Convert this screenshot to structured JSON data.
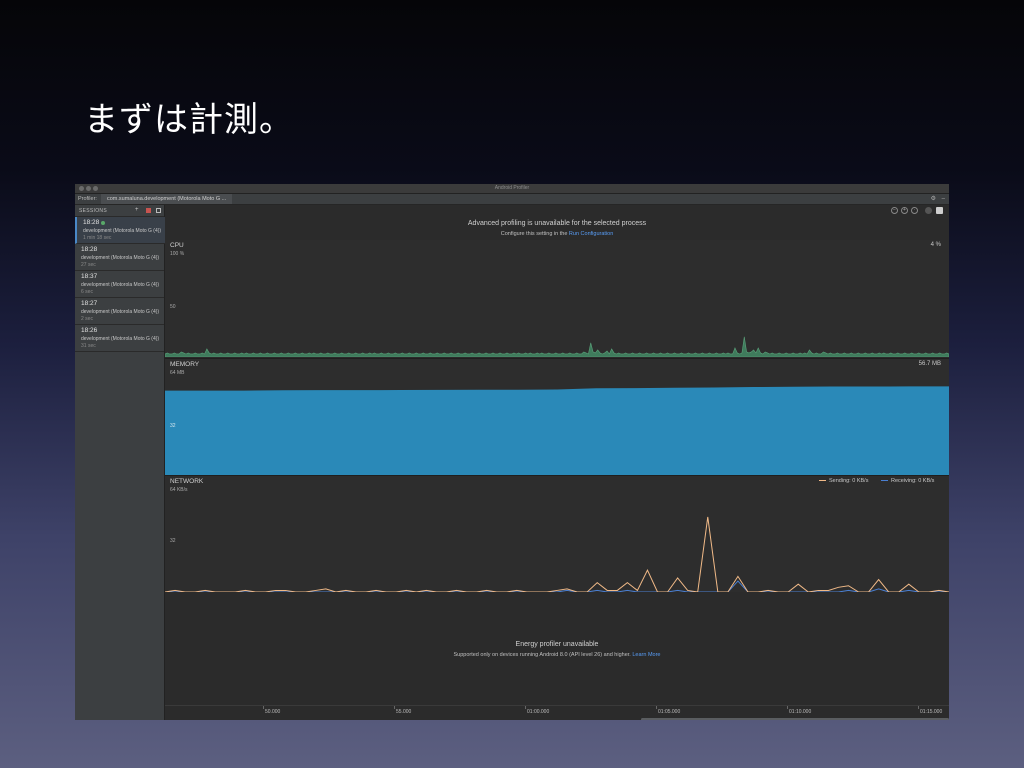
{
  "slide": {
    "title": "まずは計測。"
  },
  "window": {
    "title": "Android Profiler"
  },
  "toolbar": {
    "label": "Profiler:",
    "tab": "com.sumaluna.development (Motorola Moto G ...",
    "settings_icon": "gear-icon",
    "minimize_icon": "minimize-icon"
  },
  "sidebar": {
    "header": "SESSIONS",
    "add_icon": "plus-icon",
    "stop_icon": "stop-icon",
    "collapse_icon": "panel-collapse-icon",
    "sessions": [
      {
        "time": "18:28",
        "name": "development (Motorola Moto G (4))",
        "duration": "1 min 18 sec",
        "live": true
      },
      {
        "time": "18:28",
        "name": "development (Motorola Moto G (4))",
        "duration": "27 sec"
      },
      {
        "time": "18:37",
        "name": "development (Motorola Moto G (4))",
        "duration": "6 sec"
      },
      {
        "time": "18:27",
        "name": "development (Motorola Moto G (4))",
        "duration": "2 sec"
      },
      {
        "time": "18:26",
        "name": "development (Motorola Moto G (4))",
        "duration": "31 sec"
      }
    ]
  },
  "banner": {
    "title": "Advanced profiling is unavailable for the selected process",
    "subtitle_prefix": "Configure this setting in the ",
    "subtitle_link": "Run Configuration"
  },
  "cpu": {
    "label": "CPU",
    "value": "4 %",
    "tick_top": "100 %",
    "tick_mid": "50",
    "color": "#3f7b5c",
    "ylim": [
      0,
      100
    ],
    "samples": [
      3,
      4,
      3,
      3,
      4,
      3,
      3,
      5,
      4,
      3,
      4,
      3,
      3,
      4,
      3,
      3,
      4,
      3,
      8,
      4,
      3,
      4,
      3,
      3,
      4,
      3,
      3,
      4,
      3,
      3,
      4,
      3,
      3,
      4,
      3,
      4,
      3,
      3,
      4,
      3,
      3,
      4,
      3,
      3,
      4,
      3,
      3,
      4,
      3,
      3,
      4,
      3,
      3,
      4,
      3,
      3,
      4,
      3,
      3,
      4,
      3,
      3,
      4,
      3,
      4,
      3,
      3,
      4,
      3,
      3,
      4,
      3,
      3,
      4,
      3,
      3,
      4,
      3,
      3,
      4,
      3,
      3,
      4,
      3,
      3,
      4,
      3,
      3,
      4,
      3,
      4,
      3,
      3,
      4,
      3,
      3,
      4,
      3,
      3,
      4,
      3,
      3,
      4,
      3,
      3,
      4,
      3,
      3,
      4,
      3,
      3,
      4,
      3,
      3,
      4,
      3,
      3,
      4,
      3,
      3,
      4,
      3,
      3,
      4,
      3,
      3,
      4,
      3,
      3,
      4,
      3,
      3,
      4,
      3,
      3,
      4,
      3,
      3,
      4,
      3,
      3,
      4,
      3,
      3,
      4,
      3,
      3,
      4,
      3,
      3,
      4,
      3,
      4,
      3,
      3,
      4,
      3,
      4,
      3,
      3,
      4,
      3,
      4,
      3,
      3,
      4,
      3,
      3,
      4,
      3,
      3,
      4,
      3,
      3,
      4,
      3,
      3,
      4,
      3,
      3,
      5,
      4,
      3,
      14,
      5,
      4,
      7,
      4,
      3,
      4,
      6,
      3,
      8,
      4,
      3,
      4,
      3,
      3,
      4,
      3,
      3,
      4,
      3,
      3,
      4,
      3,
      3,
      4,
      3,
      3,
      4,
      3,
      3,
      4,
      3,
      3,
      4,
      3,
      3,
      4,
      3,
      3,
      4,
      3,
      3,
      4,
      3,
      3,
      4,
      3,
      3,
      4,
      3,
      3,
      4,
      3,
      3,
      4,
      3,
      3,
      4,
      3,
      4,
      3,
      3,
      9,
      4,
      3,
      4,
      20,
      5,
      4,
      5,
      7,
      4,
      9,
      4,
      3,
      5,
      4,
      3,
      4,
      3,
      3,
      4,
      3,
      3,
      4,
      3,
      3,
      4,
      3,
      3,
      4,
      3,
      4,
      3,
      7,
      4,
      3,
      4,
      3,
      3,
      5,
      4,
      3,
      4,
      3,
      3,
      4,
      3,
      3,
      4,
      3,
      3,
      4,
      3,
      3,
      4,
      3,
      3,
      4,
      3,
      3,
      4,
      3,
      3,
      4,
      3,
      4,
      3,
      3,
      4,
      3,
      3,
      4,
      3,
      3,
      4,
      3,
      3,
      4,
      3,
      3,
      4,
      3,
      3,
      4,
      3,
      3,
      4,
      3,
      3,
      4,
      3,
      3,
      4,
      3
    ]
  },
  "memory": {
    "label": "MEMORY",
    "value": "56.7 MB",
    "tick_top": "64 MB",
    "tick_mid": "32",
    "color": "#2a89b8",
    "ylim": [
      0,
      64
    ],
    "samples": [
      54,
      54,
      54,
      54.2,
      54.3,
      54.3,
      54.4,
      54.5,
      54.6,
      54.6,
      54.7,
      55.5,
      55.6,
      55.8,
      56,
      56.3,
      56.5,
      56.6,
      56.6,
      56.7,
      56.7
    ]
  },
  "network": {
    "label": "NETWORK",
    "tick_top": "64 KB/s",
    "tick_mid": "32",
    "ylim": [
      0,
      64
    ],
    "sending_label": "Sending: 0 KB/s",
    "receiving_label": "Receiving: 0 KB/s",
    "sending_color": "#f0b987",
    "receiving_color": "#4a7fd1",
    "sending": [
      0,
      1,
      0,
      0,
      1,
      0,
      0,
      0,
      1,
      0,
      0,
      1,
      1,
      0,
      0,
      1,
      2,
      0,
      1,
      0,
      0,
      1,
      0,
      0,
      1,
      0,
      1,
      0,
      0,
      1,
      0,
      0,
      1,
      0,
      0,
      1,
      0,
      0,
      0,
      1,
      2,
      0,
      0,
      6,
      1,
      1,
      6,
      1,
      14,
      0,
      0,
      9,
      1,
      0,
      48,
      0,
      0,
      10,
      0,
      0,
      1,
      0,
      0,
      5,
      0,
      1,
      1,
      3,
      4,
      0,
      0,
      8,
      0,
      0,
      5,
      0,
      0,
      1,
      0
    ],
    "receiving": [
      0,
      0,
      0,
      0,
      0,
      0,
      0,
      0,
      0,
      0,
      0,
      0,
      0,
      0,
      0,
      0,
      0,
      0,
      0,
      0,
      0,
      0,
      0,
      0,
      0,
      0,
      0,
      0,
      0,
      0,
      0,
      0,
      0,
      0,
      0,
      0,
      0,
      0,
      0,
      0,
      1,
      0,
      0,
      1,
      0,
      0,
      1,
      0,
      0,
      0,
      0,
      1,
      0,
      0,
      0,
      0,
      0,
      7,
      0,
      0,
      0,
      0,
      0,
      0,
      0,
      0,
      0,
      0,
      1,
      0,
      0,
      2,
      0,
      0,
      1,
      0,
      0,
      0,
      0
    ]
  },
  "energy": {
    "title": "Energy profiler unavailable",
    "subtitle_prefix": "Supported only on devices running Android 8.0 (API level 26) and higher. ",
    "subtitle_link": "Learn More"
  },
  "timeline": {
    "ticks": [
      "50.000",
      "55.000",
      "01:00.000",
      "01:05.000",
      "01:10.000",
      "01:15.000"
    ]
  }
}
